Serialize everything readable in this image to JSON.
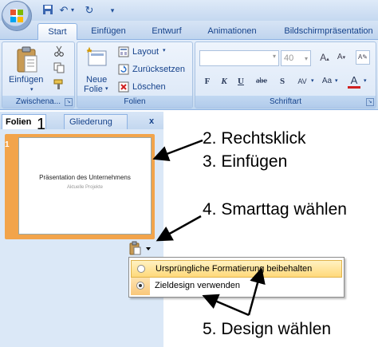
{
  "window": {
    "quick_access": [
      "save-icon",
      "undo-icon",
      "redo-icon",
      "customize-icon"
    ]
  },
  "tabs": [
    {
      "label": "Start",
      "active": true
    },
    {
      "label": "Einfügen"
    },
    {
      "label": "Entwurf"
    },
    {
      "label": "Animationen"
    },
    {
      "label": "Bildschirmpräsentation"
    }
  ],
  "ribbon": {
    "clipboard": {
      "paste_label": "Einfügen",
      "group_label": "Zwischena..."
    },
    "slides": {
      "new_slide_line1": "Neue",
      "new_slide_line2": "Folie",
      "layout_label": "Layout",
      "reset_label": "Zurücksetzen",
      "delete_label": "Löschen",
      "group_label": "Folien"
    },
    "font": {
      "font_name": "",
      "font_size": "40",
      "group_label": "Schriftart",
      "buttons": [
        "F",
        "K",
        "U",
        "abe",
        "S",
        "AV",
        "Aa",
        "A"
      ]
    }
  },
  "pane": {
    "tab_folien": "Folien",
    "tab_gliederung": "Gliederung",
    "close": "x",
    "slide_number": "1",
    "slide_title": "Präsentation des Unternehmens",
    "slide_subtitle": "Aktuelle Projekte"
  },
  "menu": {
    "item1": "Ursprüngliche Formatierung beibehalten",
    "item2": "Zieldesign verwenden"
  },
  "annotations": {
    "a1": "1",
    "a2": "2. Rechtsklick",
    "a3": "3. Einfügen",
    "a4": "4. Smarttag wählen",
    "a5": "5. Design wählen"
  },
  "colors": {
    "ribbon_text": "#15428b",
    "slide_selection": "#f2a44b",
    "menu_highlight": "#ffd97a"
  }
}
